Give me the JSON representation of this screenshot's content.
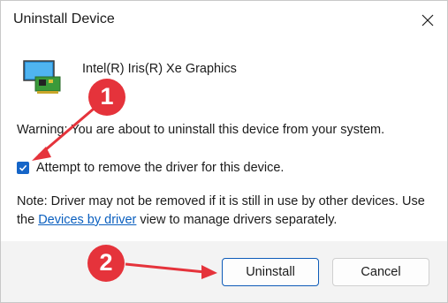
{
  "dialog": {
    "title": "Uninstall Device",
    "device_name": "Intel(R) Iris(R) Xe Graphics",
    "warning_text": "Warning: You are about to uninstall this device from your system.",
    "checkbox_label": "Attempt to remove the driver for this device.",
    "checkbox_checked": true,
    "note_prefix": "Note: Driver may not be removed if it is still in use by other devices. Use the ",
    "note_link": "Devices by driver",
    "note_suffix": " view to manage drivers separately.",
    "uninstall_label": "Uninstall",
    "cancel_label": "Cancel"
  },
  "annotations": {
    "step1": "1",
    "step2": "2",
    "color": "#e5333b"
  },
  "icons": {
    "close": "close-icon",
    "device": "display-adapter-icon",
    "checkmark": "checkmark-icon"
  }
}
